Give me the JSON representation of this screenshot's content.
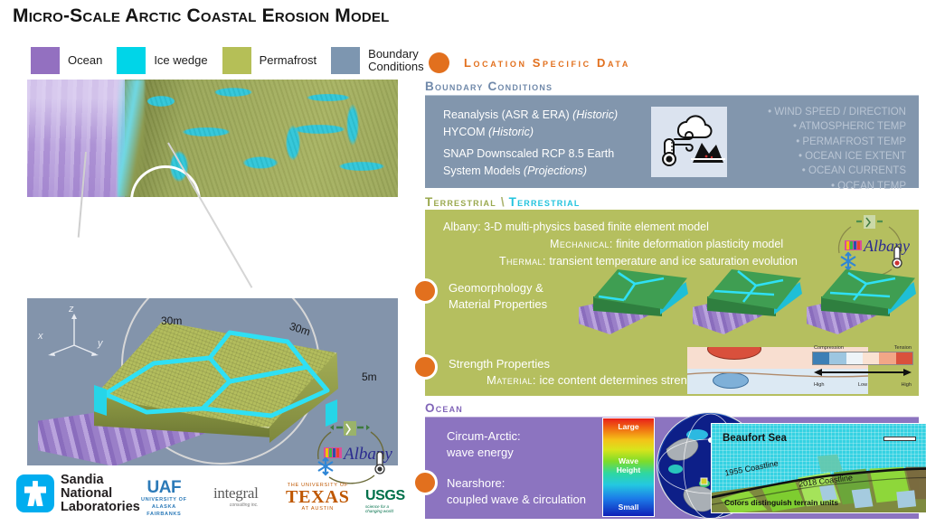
{
  "title": "Micro-Scale Arctic Coastal Erosion Model",
  "legend": {
    "items": [
      {
        "label": "Ocean",
        "color": "#9370c0"
      },
      {
        "label": "Ice wedge",
        "color": "#00d5e8"
      },
      {
        "label": "Permafrost",
        "color": "#b5bf57"
      },
      {
        "label": "Boundary\nConditions",
        "color": "#7d96b0"
      }
    ]
  },
  "block_diagram": {
    "axes": {
      "x": "x",
      "y": "y",
      "z": "z"
    },
    "dim_top_left": "30m",
    "dim_top_right": "30m",
    "dim_depth": "5m"
  },
  "logos": {
    "sandia": {
      "line1": "Sandia",
      "line2": "National",
      "line3": "Laboratories"
    },
    "uaf": {
      "main": "UAF",
      "sub1": "UNIVERSITY OF",
      "sub2": "ALASKA",
      "sub3": "FAIRBANKS"
    },
    "integral": {
      "main": "integral",
      "sub": "consulting inc."
    },
    "texas": {
      "top": "THE UNIVERSITY OF",
      "main": "TEXAS",
      "bottom": "AT AUSTIN"
    },
    "usgs": {
      "main": "USGS",
      "sub": "science for a changing world"
    }
  },
  "right": {
    "location_header": "Location Specific Data",
    "boundary": {
      "header": "Boundary Conditions",
      "lines": [
        {
          "text": "Reanalysis (ASR & ERA) ",
          "em": "(Historic)"
        },
        {
          "text": "HYCOM ",
          "em": "(Historic)"
        },
        {
          "text": "SNAP Downscaled RCP 8.5 Earth",
          "em": ""
        },
        {
          "text": "System Models ",
          "em": "(Projections)"
        }
      ],
      "icons": [
        "cloud-wind-icon",
        "thermometer-icon",
        "iceberg-icon"
      ],
      "bullets": [
        "• WIND SPEED / DIRECTION",
        "• ATMOSPHERIC TEMP",
        "• PERMAFROST TEMP",
        "• OCEAN ICE EXTENT",
        "• OCEAN CURRENTS",
        "• OCEAN TEMP"
      ]
    },
    "terrestrial": {
      "header_1": "Terrestrial",
      "header_sep": "\\",
      "header_2": "Terrestrial",
      "albany_line": "Albany:  3-D multi-physics based finite element model",
      "mechanical_label": "Mechanical:",
      "mechanical_text": "finite deformation plasticity model",
      "thermal_label": "Thermal:",
      "thermal_text": "transient temperature and ice saturation evolution",
      "geomorphology": "Geomorphology &\nMaterial Properties",
      "strength": "Strength Properties",
      "material_label": "Material:",
      "material_text": "ice content determines strength",
      "colorbar": {
        "left_title": "Compression",
        "right_title": "Tension",
        "labels": [
          "High",
          "Low",
          "High"
        ],
        "colors": [
          "#3d7fb5",
          "#9dc6e0",
          "#eef4f8",
          "#fae2d2",
          "#f2a687",
          "#d9513c"
        ]
      },
      "albany_logo": {
        "text": "Albany",
        "icons": [
          "deformation-icon",
          "snowflake-icon",
          "thermometer-icon"
        ]
      }
    },
    "ocean": {
      "header": "Ocean",
      "line1": "Circum-Arctic:\nwave energy",
      "line2": "Nearshore:\ncoupled wave & circulation",
      "wave_colorbar": {
        "top": "Large",
        "middle": "Wave\nHeight",
        "bottom": "Small"
      },
      "beaufort": {
        "title": "Beaufort Sea",
        "coast_1955": "1955 Coastline",
        "coast_2018": "2018 Coastline",
        "note": "Colors distinguish terrain units"
      }
    }
  }
}
